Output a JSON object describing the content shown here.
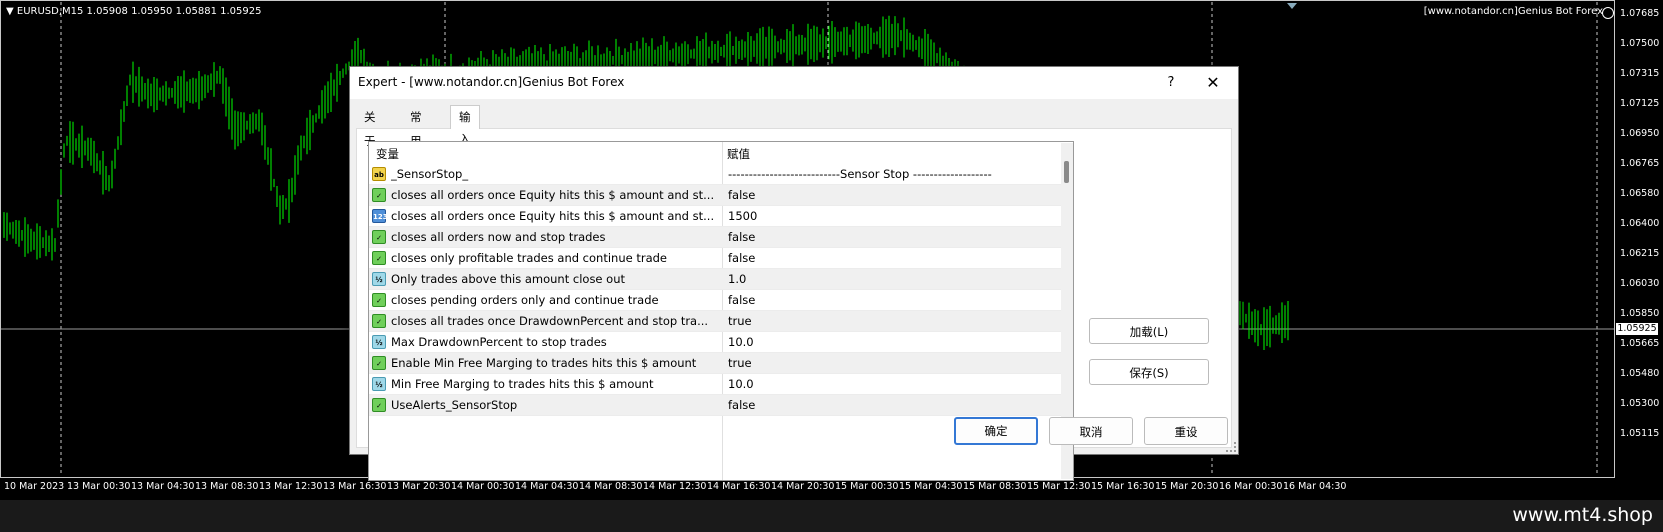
{
  "chart": {
    "symbol_label": "EURUSD,M15  1.05908 1.05950 1.05881 1.05925",
    "ea_label": "[www.notandor.cn]Genius Bot Forex",
    "current_price": "1.05925",
    "price_levels": [
      "1.07685",
      "1.07500",
      "1.07315",
      "1.07125",
      "1.06950",
      "1.06765",
      "1.06580",
      "1.06400",
      "1.06215",
      "1.06030",
      "1.05850",
      "1.05665",
      "1.05480",
      "1.05300",
      "1.05115"
    ],
    "time_labels": [
      "10 Mar 2023",
      "13 Mar 00:30",
      "13 Mar 04:30",
      "13 Mar 08:30",
      "13 Mar 12:30",
      "13 Mar 16:30",
      "13 Mar 20:30",
      "14 Mar 00:30",
      "14 Mar 04:30",
      "14 Mar 08:30",
      "14 Mar 12:30",
      "14 Mar 16:30",
      "14 Mar 20:30",
      "15 Mar 00:30",
      "15 Mar 04:30",
      "15 Mar 08:30",
      "15 Mar 12:30",
      "15 Mar 16:30",
      "15 Mar 20:30",
      "16 Mar 00:30",
      "16 Mar 04:30"
    ],
    "candle_color": "#00ff00",
    "background": "#000000"
  },
  "watermark": "www.mt4.shop",
  "dialog": {
    "title": "Expert - [www.notandor.cn]Genius Bot Forex",
    "help": "?",
    "close": "✕",
    "tabs": [
      {
        "label": "关于",
        "active": false
      },
      {
        "label": "常用",
        "active": false
      },
      {
        "label": "输入参数",
        "active": true
      }
    ],
    "grid": {
      "col_variable": "变量",
      "col_value": "赋值",
      "rows": [
        {
          "icon": "ab",
          "name": "_SensorStop_",
          "value": "---------------------------Sensor Stop -------------------"
        },
        {
          "icon": "bool",
          "name": "closes all orders once Equity hits this $ amount and st...",
          "value": "false"
        },
        {
          "icon": "num",
          "name": "closes all orders once Equity hits this $ amount and st...",
          "value": "1500"
        },
        {
          "icon": "bool",
          "name": "closes all orders now and stop trades",
          "value": "false"
        },
        {
          "icon": "bool",
          "name": "closes only profitable trades and continue trade",
          "value": "false"
        },
        {
          "icon": "dbl",
          "name": "Only trades above this amount close out",
          "value": "1.0"
        },
        {
          "icon": "bool",
          "name": "closes pending orders only and continue trade",
          "value": "false"
        },
        {
          "icon": "bool",
          "name": "closes all trades once  DrawdownPercent and stop tra...",
          "value": "true"
        },
        {
          "icon": "dbl",
          "name": "Max  DrawdownPercent to stop trades",
          "value": "10.0"
        },
        {
          "icon": "bool",
          "name": "Enable Min  Free Marging to trades hits this $ amount",
          "value": "true"
        },
        {
          "icon": "dbl",
          "name": "Min  Free Marging to trades hits this $ amount",
          "value": "10.0"
        },
        {
          "icon": "bool",
          "name": "UseAlerts_SensorStop",
          "value": "false"
        }
      ]
    },
    "buttons": {
      "load": "加载(L)",
      "save": "保存(S)",
      "ok": "确定",
      "cancel": "取消",
      "reset": "重设"
    }
  }
}
